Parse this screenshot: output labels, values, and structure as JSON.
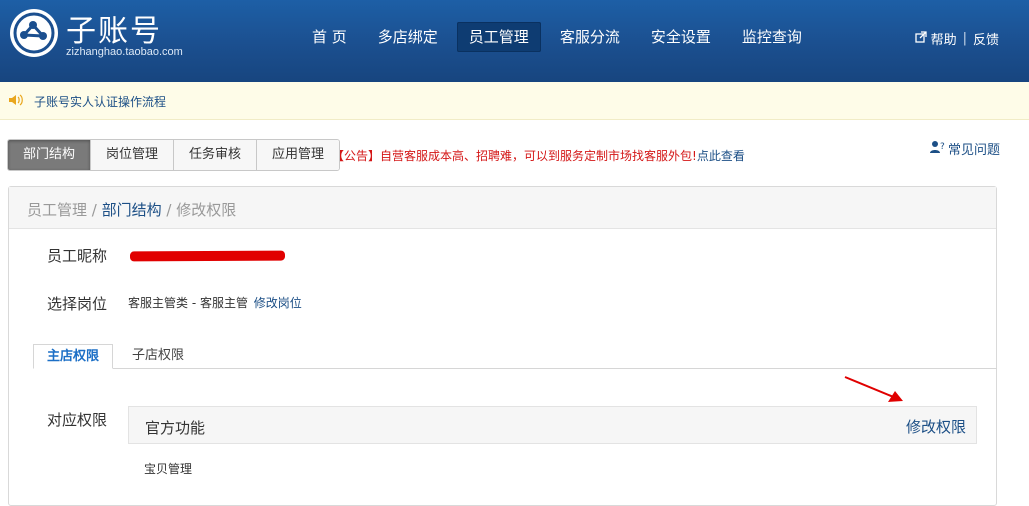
{
  "header": {
    "logo_title": "子账号",
    "logo_subtitle": "zizhanghao.taobao.com",
    "nav": [
      "首 页",
      "多店绑定",
      "员工管理",
      "客服分流",
      "安全设置",
      "监控查询"
    ],
    "help": "帮助",
    "feedback": "反馈",
    "colors": {
      "header": "#1b4f8f",
      "active_nav": "#0e3c72"
    }
  },
  "notice": {
    "text": "子账号实人认证操作流程",
    "icon": "speaker-icon"
  },
  "tabs": [
    "部门结构",
    "岗位管理",
    "任务审核",
    "应用管理"
  ],
  "announcement": {
    "prefix": "【公告】",
    "text": "自营客服成本高、招聘难，可以到服务定制市场找客服外包!",
    "link": "点此查看"
  },
  "faq": "常见问题",
  "breadcrumb": {
    "first": "员工管理",
    "sep1": " / ",
    "second": "部门结构",
    "sep2": " / ",
    "third": "修改权限"
  },
  "form": {
    "nickname_label": "员工昵称",
    "position_label": "选择岗位",
    "position_value": "客服主管类 - 客服主管",
    "position_edit": "修改岗位",
    "permission_label": "对应权限"
  },
  "subtabs": [
    "主店权限",
    "子店权限"
  ],
  "permissions": {
    "group_title": "官方功能",
    "edit_label": "修改权限",
    "first_item": "宝贝管理"
  }
}
